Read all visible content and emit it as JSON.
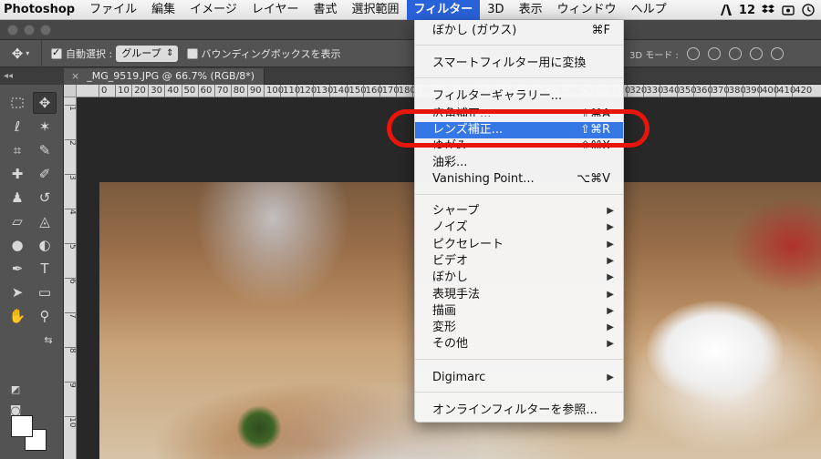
{
  "menubar": {
    "app_name": "Photoshop",
    "items": [
      "ファイル",
      "編集",
      "イメージ",
      "レイヤー",
      "書式",
      "選択範囲",
      "フィルター",
      "3D",
      "表示",
      "ウィンドウ",
      "ヘルプ"
    ],
    "active_index": 6,
    "adobe_badge": "12"
  },
  "options_bar": {
    "auto_select_label": "自動選択 :",
    "auto_select_value": "グループ",
    "bounding_box_label": "バウンディングボックスを表示",
    "mode_label": "3D モード :"
  },
  "toolbar": {
    "collapse_glyph": "◂◂"
  },
  "document_tab": {
    "title": "_MG_9519.JPG @ 66.7% (RGB/8*)"
  },
  "ruler": {
    "top_ticks": [
      "0",
      "10",
      "20",
      "30",
      "40",
      "50",
      "60",
      "70",
      "80",
      "90",
      "100",
      "110",
      "120",
      "130",
      "140",
      "150",
      "160",
      "170",
      "180",
      "190",
      "200",
      "210",
      "220",
      "230",
      "240",
      "250",
      "260",
      "270",
      "280",
      "290",
      "300",
      "310",
      "320",
      "330",
      "340",
      "350",
      "360",
      "370",
      "380",
      "390",
      "400",
      "410",
      "420"
    ],
    "left_ticks": [
      "1",
      "2",
      "3",
      "4",
      "5",
      "6",
      "7",
      "8",
      "9",
      "10"
    ]
  },
  "filter_menu": {
    "last_filter": {
      "label": "ぼかし (ガウス)",
      "shortcut": "⌘F"
    },
    "smart_filter": "スマートフィルター用に変換",
    "gallery": "フィルターギャラリー...",
    "adaptive_wide": {
      "label": "広角補正...",
      "shortcut": "⇧⌘A"
    },
    "lens_correction": {
      "label": "レンズ補正...",
      "shortcut": "⇧⌘R"
    },
    "liquify": {
      "label": "ゆがみ",
      "shortcut": "⇧⌘X"
    },
    "oil_paint": "油彩...",
    "vanishing_point": {
      "label": "Vanishing Point...",
      "shortcut": "⌥⌘V"
    },
    "submenus": [
      "シャープ",
      "ノイズ",
      "ピクセレート",
      "ビデオ",
      "ぼかし",
      "表現手法",
      "描画",
      "変形",
      "その他"
    ],
    "digimarc": "Digimarc",
    "browse_online": "オンラインフィルターを参照...",
    "arrow_glyph": "▶"
  },
  "colors": {
    "menubar_active": "#2a62d9",
    "menu_highlight": "#3578e5",
    "annotation": "#e8150c"
  },
  "icons": {
    "move_tool": "✥",
    "text_tool": "T"
  }
}
